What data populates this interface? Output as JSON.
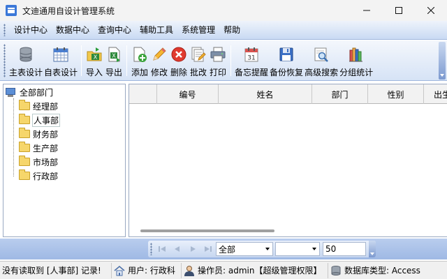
{
  "window": {
    "title": "文迪通用自设计管理系统",
    "app_icon": "app-window-icon",
    "controls": [
      "minimize-icon",
      "maximize-icon",
      "close-icon"
    ]
  },
  "menubar": {
    "items": [
      {
        "label": "设计中心"
      },
      {
        "label": "数据中心"
      },
      {
        "label": "查询中心"
      },
      {
        "label": "辅助工具"
      },
      {
        "label": "系统管理"
      },
      {
        "label": "帮助"
      }
    ]
  },
  "toolbar": {
    "groups": [
      [
        {
          "label": "主表设计",
          "icon": "database-icon"
        },
        {
          "label": "自表设计",
          "icon": "calendar-table-icon"
        }
      ],
      [
        {
          "label": "导入",
          "icon": "import-excel-icon"
        },
        {
          "label": "导出",
          "icon": "export-excel-icon"
        }
      ],
      [
        {
          "label": "添加",
          "icon": "add-document-icon"
        },
        {
          "label": "修改",
          "icon": "pencil-icon"
        },
        {
          "label": "删除",
          "icon": "delete-icon"
        },
        {
          "label": "批改",
          "icon": "batch-edit-icon"
        },
        {
          "label": "打印",
          "icon": "printer-icon"
        }
      ],
      [
        {
          "label": "备忘提醒",
          "icon": "calendar-reminder-icon"
        },
        {
          "label": "备份恢复",
          "icon": "floppy-disk-icon"
        },
        {
          "label": "高级搜索",
          "icon": "advanced-search-icon"
        },
        {
          "label": "分组统计",
          "icon": "books-icon"
        }
      ]
    ]
  },
  "tree": {
    "root": {
      "label": "全部部门",
      "icon": "computer-icon"
    },
    "children": [
      {
        "label": "经理部"
      },
      {
        "label": "人事部",
        "selected": true
      },
      {
        "label": "财务部"
      },
      {
        "label": "生产部"
      },
      {
        "label": "市场部"
      },
      {
        "label": "行政部"
      }
    ]
  },
  "grid": {
    "columns": [
      "",
      "编号",
      "姓名",
      "部门",
      "性别",
      "出生"
    ],
    "rows": []
  },
  "navigator": {
    "buttons": [
      "first-page-icon",
      "prev-page-icon",
      "next-page-icon",
      "last-page-icon"
    ],
    "filter_value": "全部",
    "second_value": "",
    "page_size": "50"
  },
  "statusbar": {
    "message": "没有读取到 [人事部] 记录!",
    "user_label": "用户: 行政科",
    "operator_label": "操作员: admin【超级管理权限】",
    "db_label": "数据库类型: Access"
  }
}
